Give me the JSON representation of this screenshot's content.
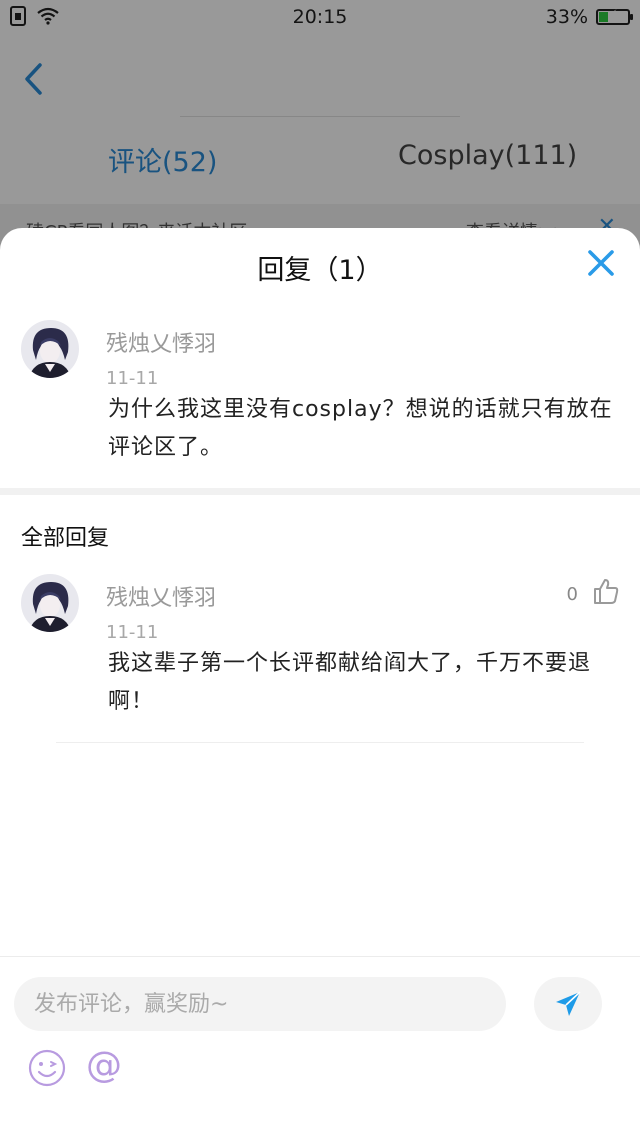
{
  "status_bar": {
    "time": "20:15",
    "battery_percent_label": "33%",
    "battery_level": 0.33,
    "icons": [
      "sim-icon",
      "wifi-icon",
      "battery-icon"
    ]
  },
  "background": {
    "tabs": [
      {
        "label": "评论(52)",
        "active": true
      },
      {
        "label": "Cosplay(111)",
        "active": false
      }
    ],
    "notice": {
      "text": "磕CP看同人图？来话本社区",
      "link": "查看详情>>"
    },
    "accent_color": "#2a8bd6"
  },
  "sheet": {
    "title": "回复（1）",
    "original_comment": {
      "username": "残烛乂悸羽",
      "date": "11-11",
      "text": "为什么我这里没有cosplay？想说的话就只有放在评论区了。"
    },
    "section_title": "全部回复",
    "replies": [
      {
        "username": "残烛乂悸羽",
        "date": "11-11",
        "text": "我这辈子第一个长评都献给阎大了，千万不要退啊！",
        "likes": "0"
      }
    ]
  },
  "input_bar": {
    "placeholder": "发布评论，赢奖励~",
    "icons": [
      "send-icon",
      "emoji-icon",
      "at-icon"
    ],
    "at_symbol": "@"
  }
}
